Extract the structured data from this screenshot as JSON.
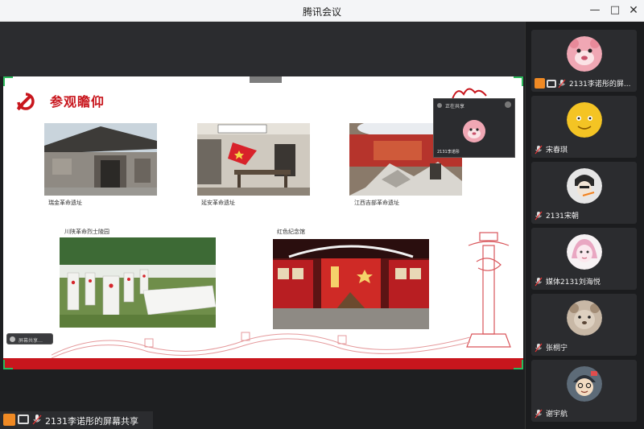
{
  "window": {
    "title": "腾讯会议",
    "controls": [
      "minimize-icon",
      "maximize-icon",
      "close-icon"
    ]
  },
  "slide": {
    "title": "参观瞻仰",
    "photos": [
      {
        "caption": "瑞金革命遗址"
      },
      {
        "caption": "延安革命遗址"
      },
      {
        "caption": "江西吉部革命遗址"
      },
      {
        "caption": "川陕革命烈士陵园"
      },
      {
        "caption": "红色纪念馆"
      }
    ],
    "accent_color": "#c8161d"
  },
  "float_panel": {
    "title": "正在共享",
    "name": "2131李诺彤"
  },
  "mini_control": {
    "label": "屏幕共享…"
  },
  "share_status": {
    "text": "2131李诺彤的屏幕共享"
  },
  "participants": [
    {
      "name": "2131李诺彤的屏...",
      "avatar": "pink-cartoon-avatar",
      "sharing": true
    },
    {
      "name": "宋春琪",
      "avatar": "yellow-cartoon-avatar",
      "sharing": false
    },
    {
      "name": "2131宋朝",
      "avatar": "sketch-avatar",
      "sharing": false
    },
    {
      "name": "媒体2131刘海悦",
      "avatar": "pink-character-avatar",
      "sharing": false
    },
    {
      "name": "张桐宁",
      "avatar": "bear-avatar",
      "sharing": false
    },
    {
      "name": "谢宇航",
      "avatar": "cartoon-boy-avatar",
      "sharing": false
    }
  ]
}
